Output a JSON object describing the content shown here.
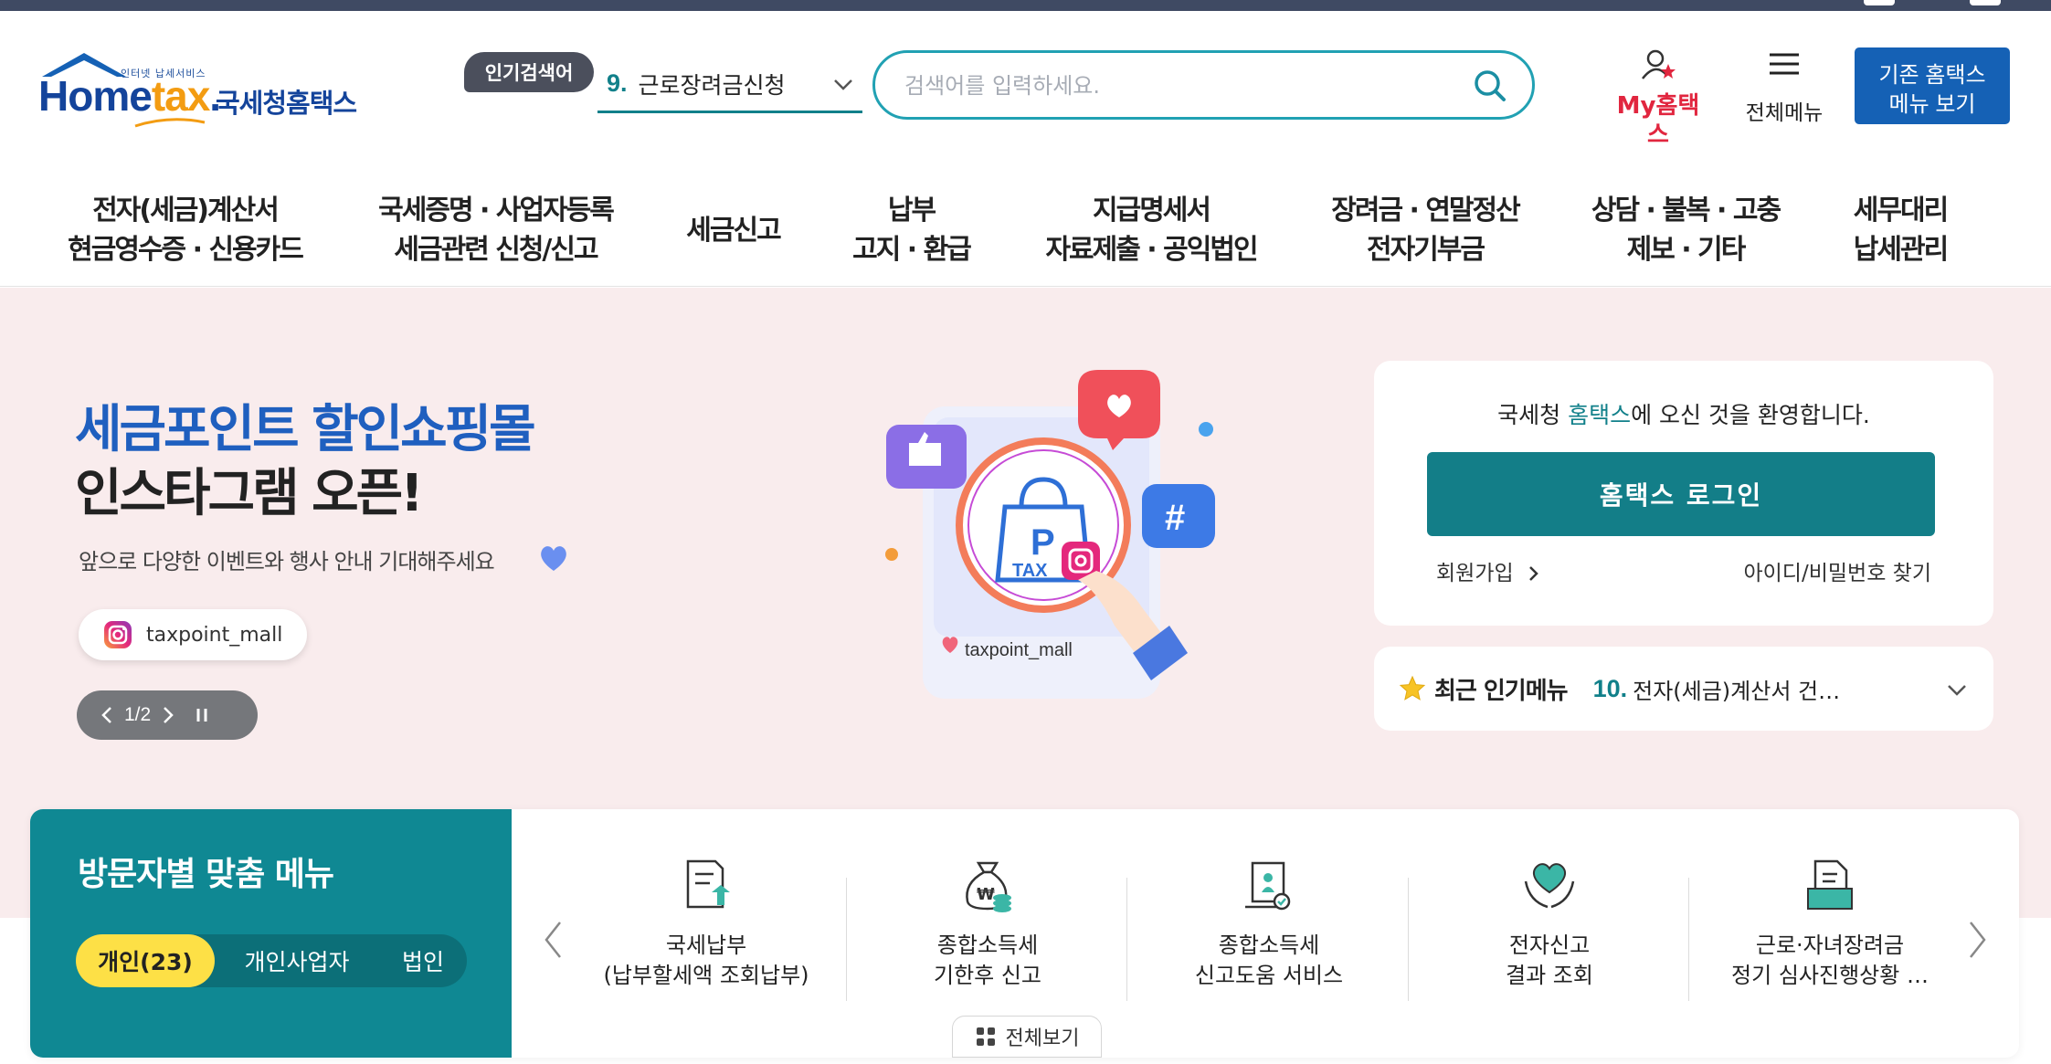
{
  "header": {
    "logo_small": "인터넷 납세서비스",
    "logo_home": "Home",
    "logo_dot": "tax",
    "logo_suffix": ".",
    "logo_ko": "국세청홈택스",
    "popular_badge": "인기검색어",
    "popular_num": "9.",
    "popular_text": "근로장려금신청",
    "search_placeholder": "검색어를 입력하세요.",
    "myhometax": "My홈택스",
    "all_menu": "전체메뉴",
    "old_home_line1": "기존 홈택스",
    "old_home_line2": "메뉴 보기"
  },
  "gnb": [
    {
      "label": "전자(세금)계산서\n현금영수증 · 신용카드"
    },
    {
      "label": "국세증명 · 사업자등록\n세금관련 신청/신고"
    },
    {
      "label": "세금신고"
    },
    {
      "label": "납부\n고지 · 환급"
    },
    {
      "label": "지급명세서\n자료제출 · 공익법인"
    },
    {
      "label": "장려금 · 연말정산\n전자기부금"
    },
    {
      "label": "상담 · 불복 · 고충\n제보 · 기타"
    },
    {
      "label": "세무대리\n납세관리"
    }
  ],
  "hero": {
    "title1": "세금포인트 할인쇼핑몰",
    "title2": "인스타그램 오픈!",
    "subtitle": "앞으로 다양한 이벤트와 행사 안내 기대해주세요",
    "insta_account": "taxpoint_mall",
    "pager": "1/2",
    "illus_account": "taxpoint_mall",
    "illus_p": "P",
    "illus_tax": "TAX"
  },
  "login": {
    "welcome_pre": "국세청 ",
    "welcome_hl": "홈택스",
    "welcome_post": "에 오신 것을 환영합니다.",
    "login_button": "홈택스 로그인",
    "join": "회원가입",
    "find": "아이디/비밀번호 찾기"
  },
  "recent": {
    "label": "최근 인기메뉴",
    "num": "10.",
    "text": "전자(세금)계산서 건…"
  },
  "visitor": {
    "title": "방문자별 맞춤 메뉴",
    "tabs": [
      "개인(23)",
      "개인사업자",
      "법인"
    ],
    "items": [
      {
        "icon": "tax-payment-icon",
        "l1": "국세납부",
        "l2": "(납부할세액 조회납부)"
      },
      {
        "icon": "money-bag-icon",
        "l1": "종합소득세",
        "l2": "기한후 신고"
      },
      {
        "icon": "tax-help-icon",
        "l1": "종합소득세",
        "l2": "신고도움 서비스"
      },
      {
        "icon": "heart-hands-icon",
        "l1": "전자신고",
        "l2": "결과 조회"
      },
      {
        "icon": "document-icon",
        "l1": "근로·자녀장려금",
        "l2": "정기 심사진행상황 …"
      }
    ],
    "view_all": "전체보기"
  },
  "colors": {
    "brand_blue": "#14449b",
    "teal": "#137e88",
    "search_border": "#21a1b3",
    "hero_bg": "#f9eced",
    "my_red": "#e1263f",
    "tab_active": "#fde046"
  }
}
